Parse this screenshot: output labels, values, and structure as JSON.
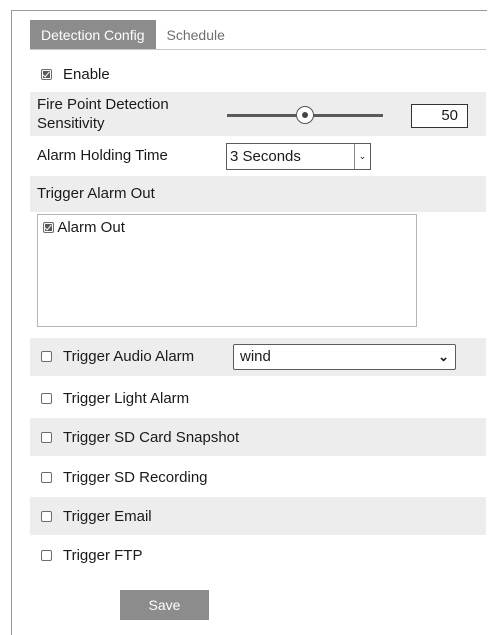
{
  "tabs": [
    {
      "label": "Detection Config"
    },
    {
      "label": "Schedule"
    }
  ],
  "enable": {
    "label": "Enable",
    "checked": true
  },
  "sensitivity": {
    "label_line1": "Fire Point Detection",
    "label_line2": "Sensitivity",
    "value": "50",
    "level": 0.5
  },
  "holding": {
    "label": "Alarm Holding Time",
    "value": "3 Seconds"
  },
  "trigger_alarm_out": {
    "label": "Trigger Alarm Out",
    "items": [
      {
        "label": "Alarm Out",
        "checked": true
      }
    ]
  },
  "audio": {
    "label": "Trigger Audio Alarm",
    "value": "wind",
    "checked": false
  },
  "light": {
    "label": "Trigger Light Alarm",
    "checked": false
  },
  "sd_snapshot": {
    "label": "Trigger SD Card Snapshot",
    "checked": false
  },
  "sd_recording": {
    "label": "Trigger SD Recording",
    "checked": false
  },
  "email": {
    "label": "Trigger Email",
    "checked": false
  },
  "ftp": {
    "label": "Trigger FTP",
    "checked": false
  },
  "save_label": "Save"
}
